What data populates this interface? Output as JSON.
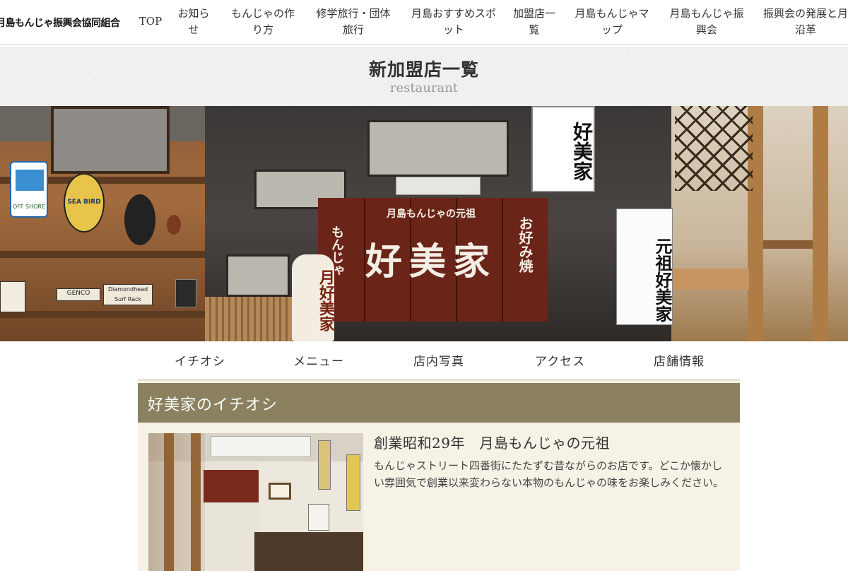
{
  "header": {
    "logo_text": "月島もんじゃ振興会協同組合",
    "nav": [
      {
        "label": "TOP"
      },
      {
        "label": "お知ら\nせ"
      },
      {
        "label": "もんじゃの作\nり方"
      },
      {
        "label": "修学旅行・団体\n旅行"
      },
      {
        "label": "月島おすすめスポ\nット"
      },
      {
        "label": "加盟店一\n覧"
      },
      {
        "label": "月島もんじゃマ\nップ"
      },
      {
        "label": "月島もんじゃ振\n興会"
      },
      {
        "label": "振興会の発展と月\n沿革"
      }
    ]
  },
  "title_band": {
    "title": "新加盟店一覧",
    "subtitle": "restaurant"
  },
  "hero": {
    "noren_small": "月島もんじゃの元祖",
    "noren_main": "好美家",
    "noren_left": "もんじゃ",
    "noren_right": "お好み焼",
    "lantern": "月好美家",
    "light_sign": "好美家",
    "white_sign": "元祖好美家",
    "sign_genco": "GENCO",
    "sign_surf": "Diamondhead Surf Rack",
    "badge_seabird": "SEA BIRD",
    "badge_offshore": "OFF SHORE"
  },
  "subnav": [
    {
      "label": "イチオシ"
    },
    {
      "label": "メニュー"
    },
    {
      "label": "店内写真"
    },
    {
      "label": "アクセス"
    },
    {
      "label": "店舗情報"
    }
  ],
  "content": {
    "heading": "好美家のイチオシ",
    "feature_title": "創業昭和29年　月島もんじゃの元祖",
    "feature_body": "もんじゃストリート四番街にたたずむ昔ながらのお店です。どこか懐かしい雰囲気で創業以来変わらない本物のもんじゃの味をお楽しみください。"
  },
  "colors": {
    "content_header": "#8b8160",
    "content_bg": "#f6f2e6",
    "noren": "#6b2418"
  }
}
